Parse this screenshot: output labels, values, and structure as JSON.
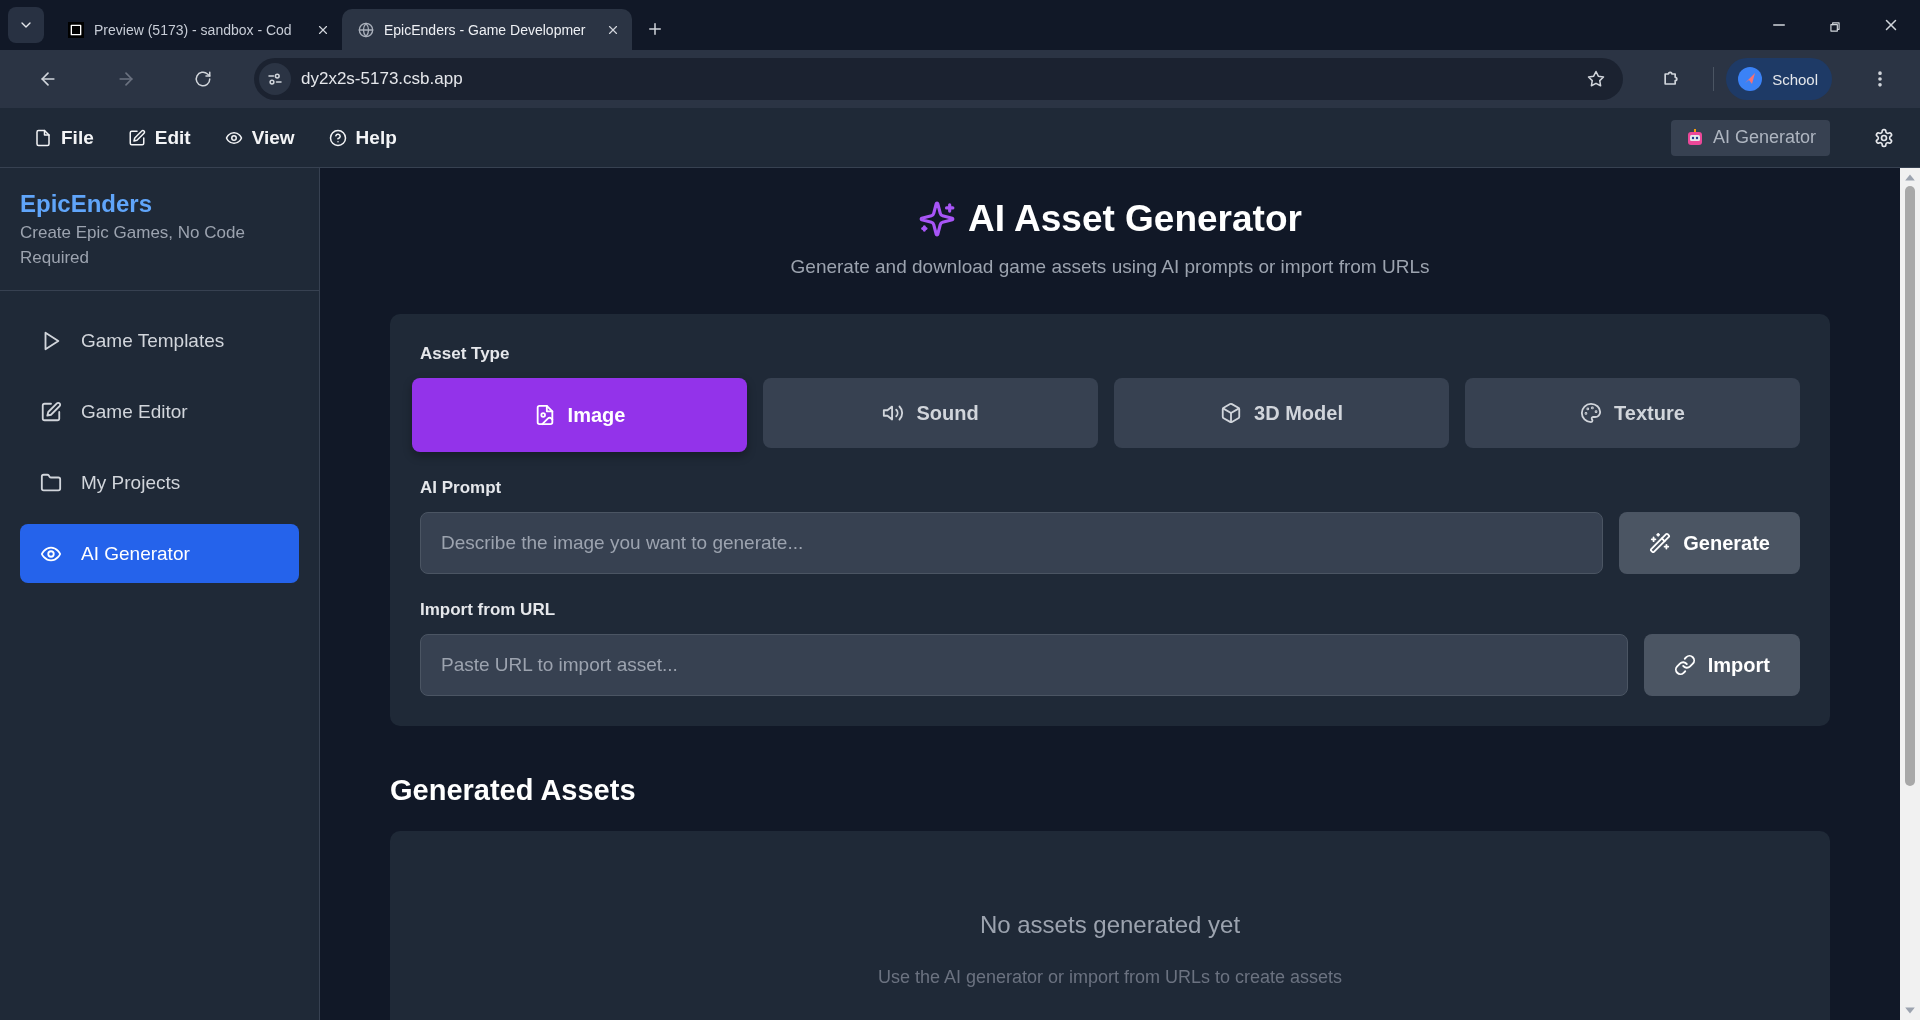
{
  "browser": {
    "tabs": [
      {
        "title": "Preview (5173) - sandbox - Cod",
        "selected": false
      },
      {
        "title": "EpicEnders - Game Developmer",
        "selected": true
      }
    ],
    "address": "dy2x2s-5173.csb.app",
    "profile": "School"
  },
  "menu": {
    "items": [
      {
        "label": "File"
      },
      {
        "label": "Edit"
      },
      {
        "label": "View"
      },
      {
        "label": "Help"
      }
    ],
    "ai_button": "AI Generator"
  },
  "sidebar": {
    "brand": "EpicEnders",
    "tagline": "Create Epic Games, No Code Required",
    "items": [
      {
        "label": "Game Templates",
        "selected": false
      },
      {
        "label": "Game Editor",
        "selected": false
      },
      {
        "label": "My Projects",
        "selected": false
      },
      {
        "label": "AI Generator",
        "selected": true
      }
    ]
  },
  "page": {
    "title": "AI Asset Generator",
    "subtitle": "Generate and download game assets using AI prompts or import from URLs"
  },
  "form": {
    "asset_type_label": "Asset Type",
    "asset_types": [
      {
        "label": "Image",
        "selected": true
      },
      {
        "label": "Sound",
        "selected": false
      },
      {
        "label": "3D Model",
        "selected": false
      },
      {
        "label": "Texture",
        "selected": false
      }
    ],
    "prompt_label": "AI Prompt",
    "prompt": {
      "placeholder": "Describe the image you want to generate..."
    },
    "generate_button": "Generate",
    "import_label": "Import from URL",
    "url": {
      "placeholder": "Paste URL to import asset..."
    },
    "import_button": "Import"
  },
  "assets": {
    "heading": "Generated Assets",
    "empty_title": "No assets generated yet",
    "empty_hint": "Use the AI generator or import from URLs to create assets"
  }
}
